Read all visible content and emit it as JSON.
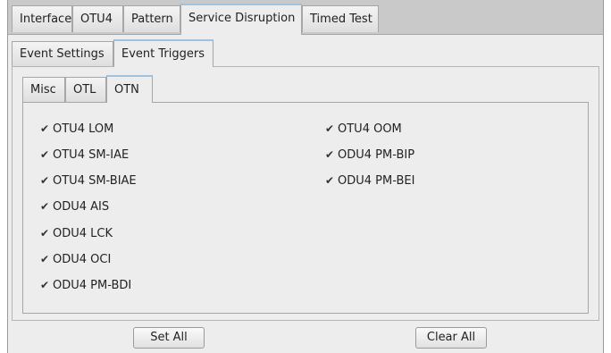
{
  "main_tabs": [
    {
      "label": "Interface",
      "active": false
    },
    {
      "label": "OTU4",
      "active": false
    },
    {
      "label": "Pattern",
      "active": false
    },
    {
      "label": "Service Disruption",
      "active": true
    },
    {
      "label": "Timed Test",
      "active": false
    }
  ],
  "sub_tabs": [
    {
      "label": "Event Settings",
      "active": false
    },
    {
      "label": "Event Triggers",
      "active": true
    }
  ],
  "inner_tabs": [
    {
      "label": "Misc",
      "active": false
    },
    {
      "label": "OTL",
      "active": false
    },
    {
      "label": "OTN",
      "active": true
    }
  ],
  "checkboxes_left": [
    {
      "label": "OTU4 LOM",
      "checked": true
    },
    {
      "label": "OTU4 SM-IAE",
      "checked": true
    },
    {
      "label": "OTU4 SM-BIAE",
      "checked": true
    },
    {
      "label": "ODU4 AIS",
      "checked": true
    },
    {
      "label": "ODU4 LCK",
      "checked": true
    },
    {
      "label": "ODU4 OCI",
      "checked": true
    },
    {
      "label": "ODU4 PM-BDI",
      "checked": true
    }
  ],
  "checkboxes_right": [
    {
      "label": "OTU4 OOM",
      "checked": true
    },
    {
      "label": "ODU4 PM-BIP",
      "checked": true
    },
    {
      "label": "ODU4 PM-BEI",
      "checked": true
    }
  ],
  "checkmark_glyph": "✔",
  "buttons": {
    "set_all": "Set All",
    "clear_all": "Clear All"
  }
}
